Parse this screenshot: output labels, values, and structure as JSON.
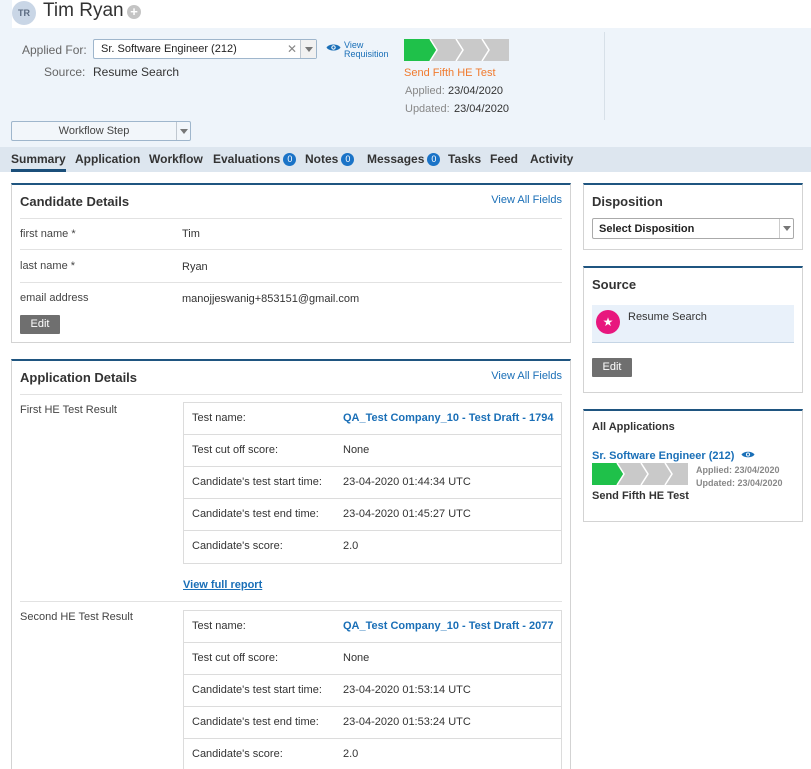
{
  "candidate": {
    "initials": "TR",
    "name": "Tim Ryan"
  },
  "header": {
    "applied_for_label": "Applied For:",
    "job_selected": "Sr. Software Engineer (212)",
    "view_requisition": "View Requisition",
    "source_label": "Source:",
    "source_value": "Resume Search",
    "pipeline": {
      "stages_total": 4,
      "stages_completed": 1,
      "colors": {
        "completed": "#1fc14a",
        "pending": "#c9c9c9"
      }
    },
    "next_step": "Send Fifth HE Test",
    "applied_label": "Applied:",
    "applied_date": "23/04/2020",
    "updated_label": "Updated:",
    "updated_date": "23/04/2020",
    "workflow_step": "Workflow Step"
  },
  "tabs": [
    {
      "label": "Summary",
      "active": true
    },
    {
      "label": "Application"
    },
    {
      "label": "Workflow"
    },
    {
      "label": "Evaluations",
      "badge": "0"
    },
    {
      "label": "Notes",
      "badge": "0"
    },
    {
      "label": "Messages",
      "badge": "0"
    },
    {
      "label": "Tasks"
    },
    {
      "label": "Feed"
    },
    {
      "label": "Activity"
    }
  ],
  "candidate_details": {
    "title": "Candidate Details",
    "view_all": "View All Fields",
    "fields": [
      {
        "label": "first name",
        "required": "*",
        "value": "Tim"
      },
      {
        "label": "last name",
        "required": "*",
        "value": "Ryan"
      },
      {
        "label": "email address",
        "value": "manojjeswanig+853151@gmail.com"
      }
    ],
    "edit": "Edit"
  },
  "application_details": {
    "title": "Application Details",
    "view_all": "View All Fields",
    "results": [
      {
        "label": "First HE Test Result",
        "rows": [
          {
            "k": "Test name:",
            "v": "QA_Test Company_10 - Test Draft - 1794",
            "link": true
          },
          {
            "k": "Test cut off score:",
            "v": "None"
          },
          {
            "k": "Candidate's test start time:",
            "v": "23-04-2020 01:44:34 UTC"
          },
          {
            "k": "Candidate's test end time:",
            "v": "23-04-2020 01:45:27 UTC"
          },
          {
            "k": "Candidate's score:",
            "v": "2.0"
          }
        ],
        "full_report": "View full report"
      },
      {
        "label": "Second HE Test Result",
        "rows": [
          {
            "k": "Test name:",
            "v": "QA_Test Company_10 - Test Draft - 2077",
            "link": true
          },
          {
            "k": "Test cut off score:",
            "v": "None"
          },
          {
            "k": "Candidate's test start time:",
            "v": "23-04-2020 01:53:14 UTC"
          },
          {
            "k": "Candidate's test end time:",
            "v": "23-04-2020 01:53:24 UTC"
          },
          {
            "k": "Candidate's score:",
            "v": "2.0"
          }
        ]
      }
    ]
  },
  "disposition": {
    "title": "Disposition",
    "select": "Select Disposition"
  },
  "source": {
    "title": "Source",
    "value": "Resume Search",
    "edit": "Edit"
  },
  "all_applications": {
    "title": "All Applications",
    "job": "Sr. Software Engineer (212)",
    "applied": "Applied: 23/04/2020",
    "updated": "Updated: 23/04/2020",
    "step": "Send Fifth HE Test"
  }
}
